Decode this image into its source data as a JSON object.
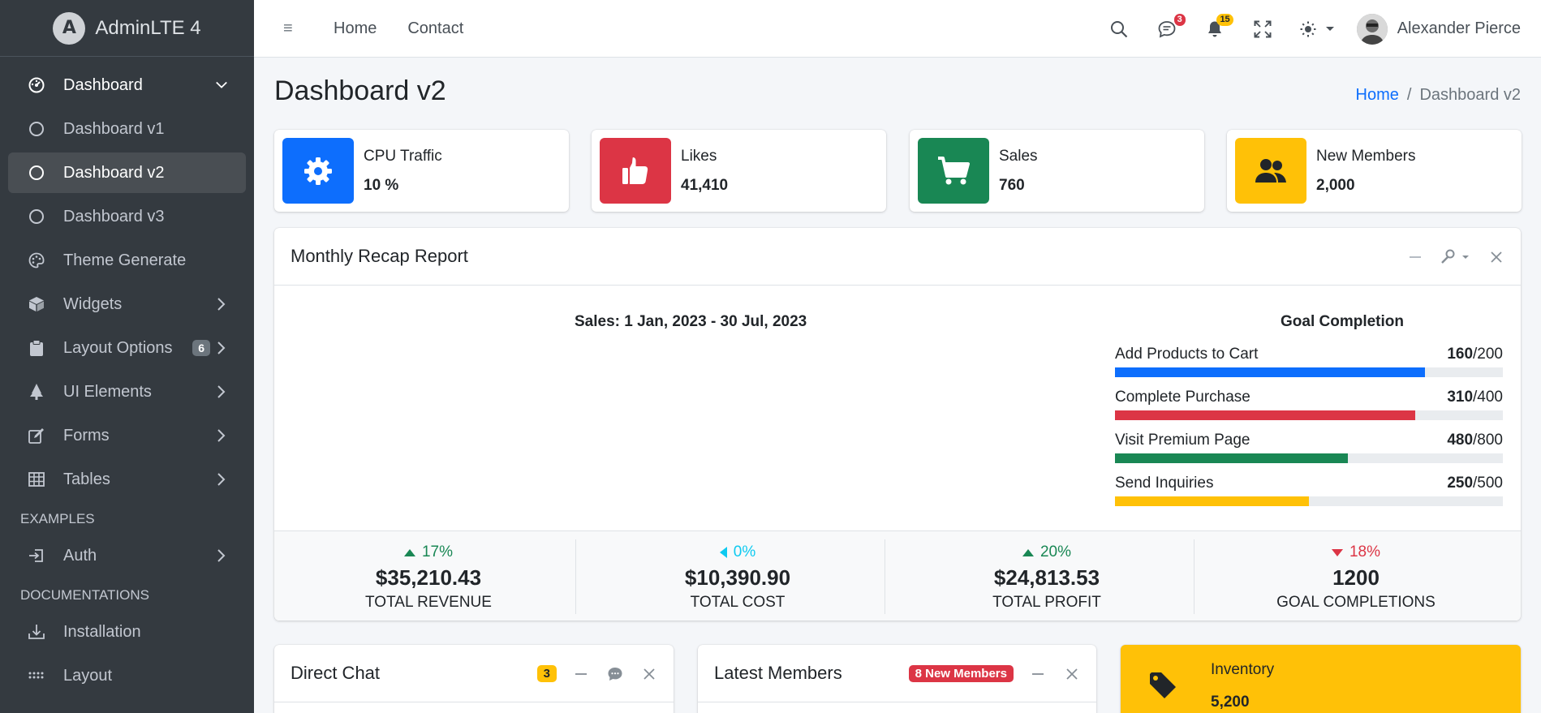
{
  "brand": {
    "name": "AdminLTE 4"
  },
  "sidebar": {
    "items": [
      {
        "label": "Dashboard",
        "icon": "speedometer-icon"
      },
      {
        "label": "Dashboard v1",
        "icon": "circle-icon"
      },
      {
        "label": "Dashboard v2",
        "icon": "circle-icon"
      },
      {
        "label": "Dashboard v3",
        "icon": "circle-icon"
      },
      {
        "label": "Theme Generate",
        "icon": "palette-icon"
      },
      {
        "label": "Widgets",
        "icon": "box-icon"
      },
      {
        "label": "Layout Options",
        "icon": "clipboard-icon",
        "badge": "6"
      },
      {
        "label": "UI Elements",
        "icon": "tree-icon"
      },
      {
        "label": "Forms",
        "icon": "pencil-square-icon"
      },
      {
        "label": "Tables",
        "icon": "table-icon"
      }
    ],
    "header_examples": "EXAMPLES",
    "auth": {
      "label": "Auth",
      "icon": "login-icon"
    },
    "header_docs": "DOCUMENTATIONS",
    "installation": {
      "label": "Installation",
      "icon": "download-icon"
    },
    "layout": {
      "label": "Layout",
      "icon": "grip-icon"
    }
  },
  "topbar": {
    "menu_icon": "≡",
    "links": [
      "Home",
      "Contact"
    ],
    "messages_count": "3",
    "notifications_count": "15",
    "user_name": "Alexander Pierce"
  },
  "page": {
    "title": "Dashboard v2",
    "breadcrumb": {
      "home": "Home",
      "sep": "/",
      "current": "Dashboard v2"
    }
  },
  "info_boxes": [
    {
      "label": "CPU Traffic",
      "value": "10 %",
      "icon": "gear-icon",
      "color": "#0d6efd"
    },
    {
      "label": "Likes",
      "value": "41,410",
      "icon": "thumbs-up-icon",
      "color": "#dc3545"
    },
    {
      "label": "Sales",
      "value": "760",
      "icon": "cart-icon",
      "color": "#198754"
    },
    {
      "label": "New Members",
      "value": "2,000",
      "icon": "people-icon",
      "color": "#ffc107"
    }
  ],
  "recap": {
    "title": "Monthly Recap Report",
    "sales_title": "Sales: 1 Jan, 2023 - 30 Jul, 2023",
    "goal_title": "Goal Completion",
    "goals": [
      {
        "label": "Add Products to Cart",
        "done": "160",
        "total": "/200",
        "fraction": 0.8,
        "color": "#0d6efd"
      },
      {
        "label": "Complete Purchase",
        "done": "310",
        "total": "/400",
        "fraction": 0.775,
        "color": "#dc3545"
      },
      {
        "label": "Visit Premium Page",
        "done": "480",
        "total": "/800",
        "fraction": 0.6,
        "color": "#198754"
      },
      {
        "label": "Send Inquiries",
        "done": "250",
        "total": "/500",
        "fraction": 0.5,
        "color": "#ffc107"
      }
    ],
    "stats": [
      {
        "pct": "17%",
        "trend": "up",
        "color": "#198754",
        "amount": "$35,210.43",
        "label": "TOTAL REVENUE"
      },
      {
        "pct": "0%",
        "trend": "left",
        "color": "#0dcaf0",
        "amount": "$10,390.90",
        "label": "TOTAL COST"
      },
      {
        "pct": "20%",
        "trend": "up",
        "color": "#198754",
        "amount": "$24,813.53",
        "label": "TOTAL PROFIT"
      },
      {
        "pct": "18%",
        "trend": "down",
        "color": "#dc3545",
        "amount": "1200",
        "label": "GOAL COMPLETIONS"
      }
    ]
  },
  "direct_chat": {
    "title": "Direct Chat",
    "badge": "3"
  },
  "latest_members": {
    "title": "Latest Members",
    "badge": "8 New Members"
  },
  "inventory": {
    "label": "Inventory",
    "value": "5,200"
  }
}
